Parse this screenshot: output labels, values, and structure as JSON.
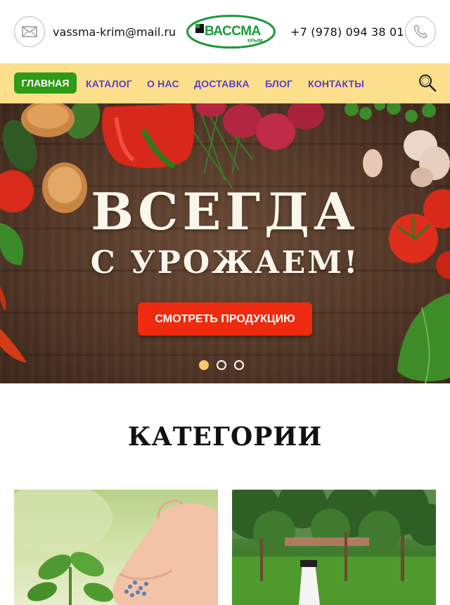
{
  "header": {
    "email": "vassma-krim@mail.ru",
    "phone": "+7 (978) 094 38 01",
    "logo": {
      "brand": "ВАССМА",
      "region": "КРЫМ"
    }
  },
  "nav": {
    "items": [
      {
        "label": "ГЛАВНАЯ",
        "active": true
      },
      {
        "label": "КАТАЛОГ",
        "active": false
      },
      {
        "label": "О НАС",
        "active": false
      },
      {
        "label": "ДОСТАВКА",
        "active": false
      },
      {
        "label": "БЛОГ",
        "active": false
      },
      {
        "label": "КОНТАКТЫ",
        "active": false
      }
    ],
    "search_icon": "search-icon"
  },
  "hero": {
    "title": "ВСЕГДА",
    "subtitle": "С УРОЖАЕМ!",
    "button_label": "СМОТРЕТЬ ПРОДУКЦИЮ",
    "slides": [
      {
        "active": true
      },
      {
        "active": false
      },
      {
        "active": false
      }
    ]
  },
  "categories": {
    "title": "КАТЕГОРИИ"
  },
  "colors": {
    "nav_bg": "#fbdf8b",
    "nav_text": "#5b3fc4",
    "active_bg": "#2f9b16",
    "cta_bg": "#ee2b0f",
    "logo_green": "#1a9a3a"
  }
}
